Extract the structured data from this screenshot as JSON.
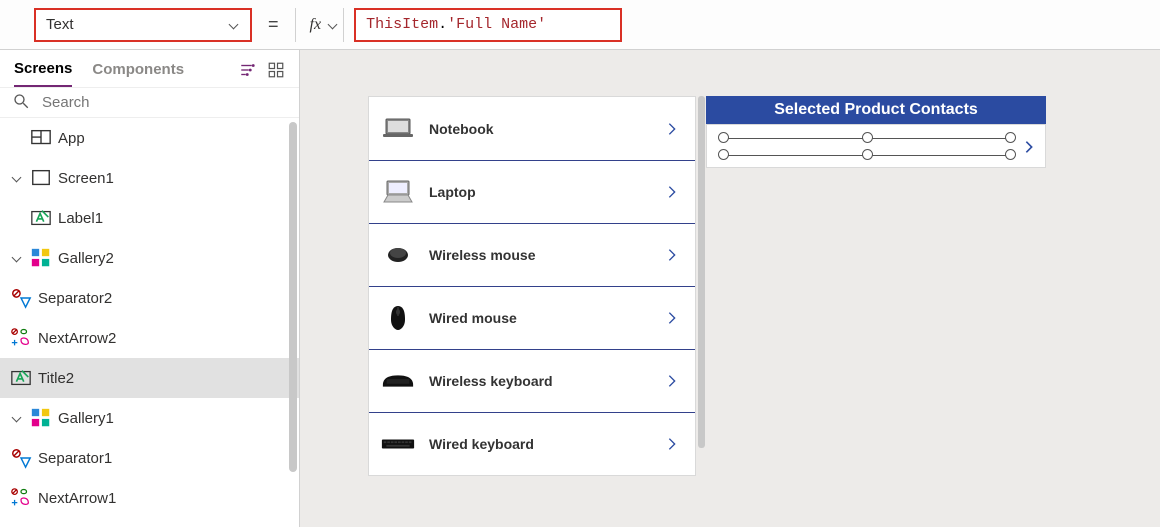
{
  "formula_bar": {
    "property_label": "Text",
    "equals": "=",
    "fx_label": "fx",
    "formula_prefix": "ThisItem",
    "formula_dot": ".",
    "formula_suffix": "'Full Name'"
  },
  "left_panel": {
    "tabs": {
      "screens": "Screens",
      "components": "Components"
    },
    "search_placeholder": "Search",
    "tree": {
      "app": "App",
      "screen1": "Screen1",
      "label1": "Label1",
      "gallery2": "Gallery2",
      "separator2": "Separator2",
      "nextarrow2": "NextArrow2",
      "title2": "Title2",
      "gallery1": "Gallery1",
      "separator1": "Separator1",
      "nextarrow1": "NextArrow1"
    }
  },
  "canvas": {
    "contacts_header": "Selected Product Contacts",
    "products": [
      {
        "name": "Notebook"
      },
      {
        "name": "Laptop"
      },
      {
        "name": "Wireless mouse"
      },
      {
        "name": "Wired mouse"
      },
      {
        "name": "Wireless keyboard"
      },
      {
        "name": "Wired keyboard"
      }
    ]
  }
}
